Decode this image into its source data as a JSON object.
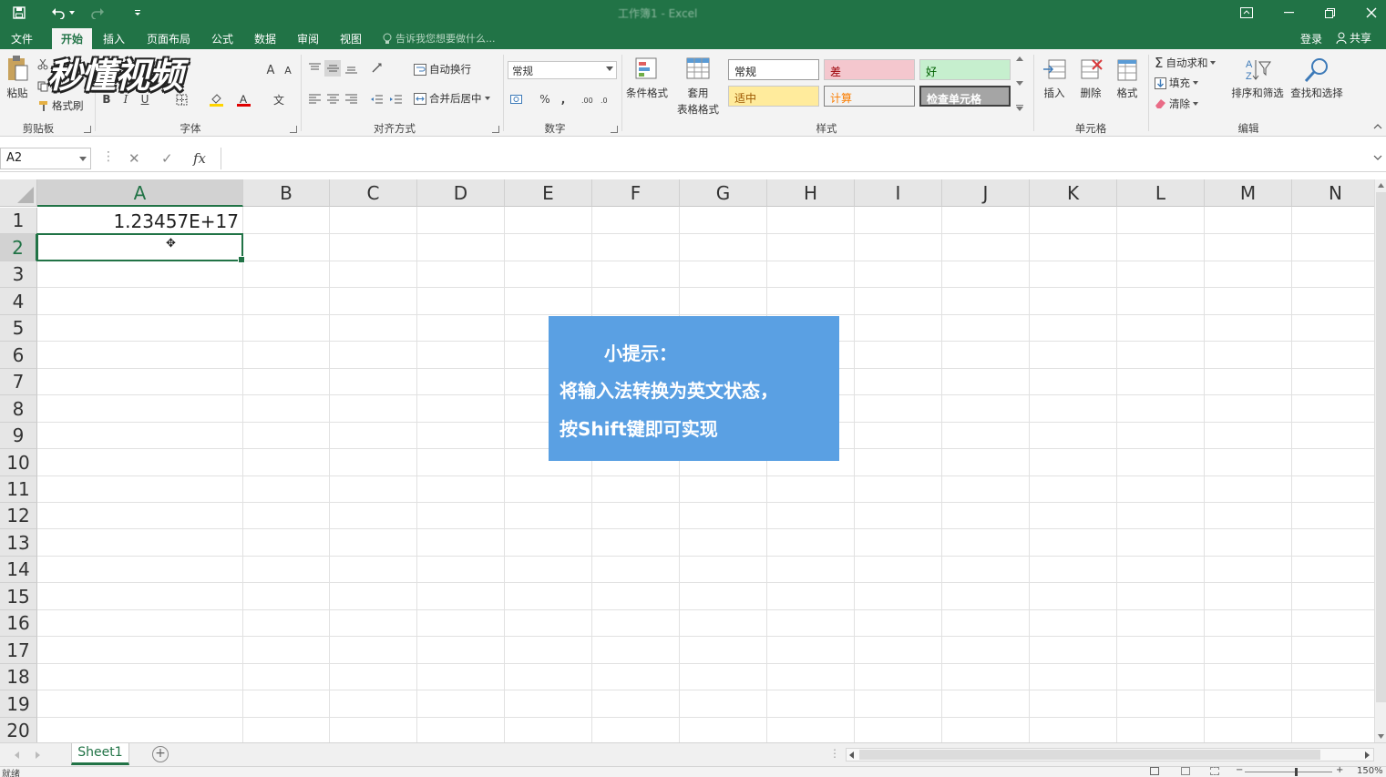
{
  "title": "工作簿1 - Excel",
  "colors": {
    "brand": "#217346",
    "tip_bg": "#5aa0e3",
    "style_bad": "#f4c7ce",
    "style_good": "#c6efce",
    "style_neutral": "#ffeb9c",
    "style_check": "#a5a5a5"
  },
  "menu": {
    "tabs": [
      {
        "label": "文件"
      },
      {
        "label": "开始"
      },
      {
        "label": "插入"
      },
      {
        "label": "页面布局"
      },
      {
        "label": "公式"
      },
      {
        "label": "数据"
      },
      {
        "label": "审阅"
      },
      {
        "label": "视图"
      }
    ],
    "active_tab": "开始",
    "tell_me": "告诉我您想要做什么...",
    "login": "登录",
    "share": "共享"
  },
  "watermark": "秒懂视频",
  "ribbon": {
    "clipboard": {
      "paste": "粘贴",
      "format_painter": "格式刷",
      "label": "剪贴板"
    },
    "font": {
      "bold": "B",
      "italic": "I",
      "underline": "U",
      "label": "字体"
    },
    "align": {
      "wrap": "自动换行",
      "merge": "合并后居中",
      "label": "对齐方式"
    },
    "number": {
      "format": "常规",
      "percent": "%",
      "comma": ",",
      "label": "数字"
    },
    "styles": {
      "conditional": "条件格式",
      "table_format_1": "套用",
      "table_format_2": "表格格式",
      "normal": "常规",
      "bad": "差",
      "good": "好",
      "neutral": "适中",
      "calc": "计算",
      "check": "检查单元格",
      "label": "样式"
    },
    "cells": {
      "insert": "插入",
      "delete": "删除",
      "format": "格式",
      "label": "单元格"
    },
    "editing": {
      "autosum": "自动求和",
      "fill": "填充",
      "clear": "清除",
      "sort": "排序和筛选",
      "find": "查找和选择",
      "label": "编辑"
    }
  },
  "formula_bar": {
    "name_box": "A2",
    "cancel": "✕",
    "enter": "✓",
    "fx": "fx",
    "value": ""
  },
  "grid": {
    "columns": [
      "A",
      "B",
      "C",
      "D",
      "E",
      "F",
      "G",
      "H",
      "I",
      "J",
      "K",
      "L",
      "M",
      "N"
    ],
    "rows": [
      "1",
      "2",
      "3",
      "4",
      "5",
      "6",
      "7",
      "8",
      "9",
      "10",
      "11",
      "12",
      "13",
      "14",
      "15",
      "16",
      "17",
      "18",
      "19",
      "20"
    ],
    "selected_cell": "A2",
    "cells": {
      "A1": "1.23457E+17"
    }
  },
  "tip": {
    "title": "小提示：",
    "line1": "将输入法转换为英文状态，",
    "line2": "按Shift键即可实现"
  },
  "sheets": {
    "tabs": [
      "Sheet1"
    ],
    "active": "Sheet1",
    "add": "+"
  },
  "status": {
    "ready": "就绪",
    "zoom": "150%"
  }
}
